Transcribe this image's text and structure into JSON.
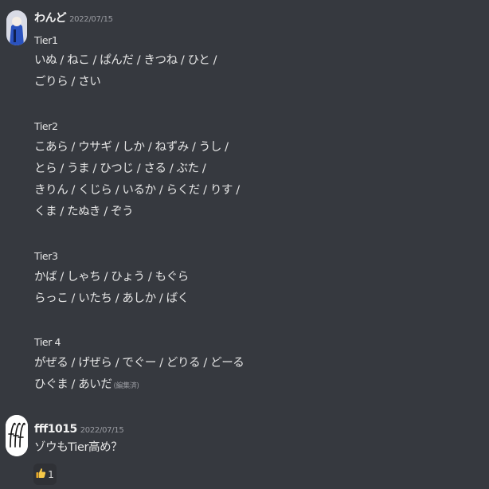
{
  "messages": [
    {
      "username": "わんど",
      "timestamp": "2022/07/15",
      "lines": [
        "Tier1",
        "いぬ / ねこ / ぱんだ / きつね / ひと /",
        "ごりら / さい",
        "Tier2",
        "こあら / ウサギ / しか / ねずみ / うし /",
        "とら / うま / ひつじ / さる / ぶた /",
        "きりん / くじら / いるか / らくだ / りす /",
        "くま / たぬき / ぞう",
        "Tier3",
        "かば / しゃち / ひょう / もぐら",
        "らっこ / いたち / あしか / ばく",
        "Tier 4",
        "がぜる / げぜら / でぐー / どりる / どーる",
        "ひぐま / あいだ"
      ],
      "edited_label": "(編集済)"
    },
    {
      "username": "fff1015",
      "timestamp": "2022/07/15",
      "lines": [
        "ゾウもTier高め？"
      ],
      "reaction": {
        "emoji": "👍",
        "count": "1"
      }
    }
  ],
  "colors": {
    "background": "#36393f",
    "username": "#f0f0f0",
    "timestamp": "#9a9ca2",
    "text": "#e6e6e6",
    "reaction_bg": "#2f3136"
  },
  "icons": {
    "avatar1": "user-avatar-icon",
    "avatar2": "fff-logo-avatar-icon",
    "reaction": "thumbs-up-icon"
  }
}
